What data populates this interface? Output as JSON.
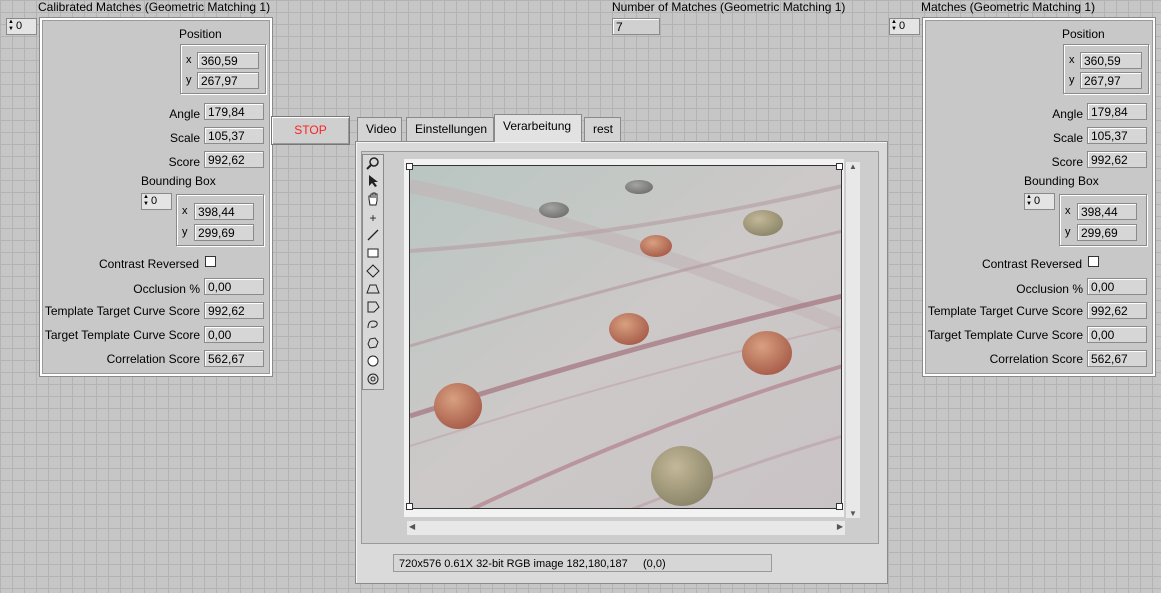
{
  "left": {
    "title": "Calibrated Matches (Geometric Matching 1)",
    "index": "0",
    "position_label": "Position",
    "x_label": "x",
    "x": "360,59",
    "y_label": "y",
    "y": "267,97",
    "angle_label": "Angle",
    "angle": "179,84",
    "scale_label": "Scale",
    "scale": "105,37",
    "score_label": "Score",
    "score": "992,62",
    "bbox_label": "Bounding Box",
    "bbox_index": "0",
    "bbox_x_label": "x",
    "bbox_x": "398,44",
    "bbox_y_label": "y",
    "bbox_y": "299,69",
    "contrast_label": "Contrast Reversed",
    "occlusion_label": "Occlusion %",
    "occlusion": "0,00",
    "ttc_label": "Template Target Curve Score",
    "ttc": "992,62",
    "ttc2_label": "Target Template Curve Score",
    "ttc2": "0,00",
    "corr_label": "Correlation Score",
    "corr": "562,67"
  },
  "right": {
    "title": "Matches (Geometric Matching 1)",
    "index": "0",
    "position_label": "Position",
    "x_label": "x",
    "x": "360,59",
    "y_label": "y",
    "y": "267,97",
    "angle_label": "Angle",
    "angle": "179,84",
    "scale_label": "Scale",
    "scale": "105,37",
    "score_label": "Score",
    "score": "992,62",
    "bbox_label": "Bounding Box",
    "bbox_index": "0",
    "bbox_x_label": "x",
    "bbox_x": "398,44",
    "bbox_y_label": "y",
    "bbox_y": "299,69",
    "contrast_label": "Contrast Reversed",
    "occlusion_label": "Occlusion %",
    "occlusion": "0,00",
    "ttc_label": "Template Target Curve Score",
    "ttc": "992,62",
    "ttc2_label": "Target Template Curve Score",
    "ttc2": "0,00",
    "corr_label": "Correlation Score",
    "corr": "562,67"
  },
  "number_matches": {
    "label": "Number of Matches (Geometric Matching 1)",
    "value": "7"
  },
  "stop_label": "STOP",
  "tabs": [
    "Video",
    "Einstellungen",
    "Verarbeitung",
    "rest"
  ],
  "active_tab": "Verarbeitung",
  "status": "720x576 0.61X 32-bit RGB image 182,180,187     (0,0)",
  "tools": [
    "zoom-icon",
    "pointer-icon",
    "pan-icon",
    "point-icon",
    "line-icon",
    "rectangle-icon",
    "rotated-rect-icon",
    "annulus-icon",
    "polygon-icon",
    "freehand-icon",
    "broken-line-icon",
    "oval-icon",
    "rotate-icon"
  ],
  "colors": {
    "stop_text": "#ff2020",
    "background": "#c6c6c6"
  }
}
